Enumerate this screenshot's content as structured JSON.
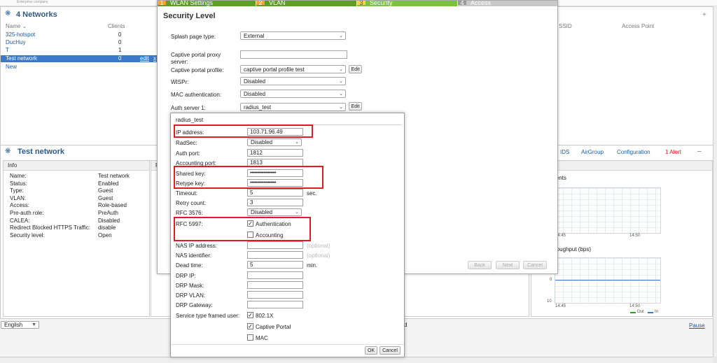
{
  "brand": "Enterprise company",
  "networks": {
    "title": "4 Networks",
    "col_name": "Name ⌄",
    "col_clients": "Clients",
    "col_ssid": "SSID",
    "col_ap": "Access Point",
    "rows": [
      {
        "name": "325-hotspot",
        "clients": "0"
      },
      {
        "name": "DucHuy",
        "clients": "0"
      },
      {
        "name": "T",
        "clients": "1"
      },
      {
        "name": "Test network",
        "clients": "0"
      }
    ],
    "edit": "edit",
    "delete": "x",
    "new": "New",
    "plus": "+"
  },
  "detail": {
    "title": "Test network",
    "tabs": [
      "IDS",
      "AirGroup",
      "Configuration"
    ],
    "alert": "1 Alert",
    "minimize": "–",
    "info_header": "Info",
    "info": [
      {
        "k": "Name:",
        "v": "Test network"
      },
      {
        "k": "Status:",
        "v": "Enabled"
      },
      {
        "k": "Type:",
        "v": "Guest"
      },
      {
        "k": "VLAN:",
        "v": "Guest"
      },
      {
        "k": "Access:",
        "v": "Role-based"
      },
      {
        "k": "Pre-auth role:",
        "v": "PreAuth"
      },
      {
        "k": "CALEA:",
        "v": "Disabled"
      },
      {
        "k": "Redirect Blocked HTTPS Traffic:",
        "v": "disable"
      },
      {
        "k": "Security level:",
        "v": "Open"
      }
    ],
    "mid_header": "R",
    "trends_header": "rends",
    "clients_title": "ients",
    "throughput_title": "roughput  (bps)",
    "tick_1445": "14:45",
    "tick_1450": "14:50",
    "y_0": "0",
    "y_10": "10",
    "legend_out": "Out",
    "legend_in": "In"
  },
  "footer": {
    "language": "English",
    "pause": "Pause",
    "d": "d"
  },
  "wizard": {
    "steps": [
      {
        "num": "1",
        "label": "WLAN Settings"
      },
      {
        "num": "2",
        "label": "VLAN"
      },
      {
        "num": "3",
        "label": "Security"
      },
      {
        "num": "4",
        "label": "Access"
      }
    ],
    "title": "Security Level",
    "splash_label": "Splash page type:",
    "splash_value": "External",
    "proxy_label": "Captive portal proxy server:",
    "proxy_value": "",
    "profile_label": "Captive portal profile:",
    "profile_value": "captive portal profile test",
    "wispr_label": "WISPr:",
    "wispr_value": "Disabled",
    "mac_label": "MAC authentication:",
    "mac_value": "Disabled",
    "auth_label": "Auth server 1:",
    "auth_value": "radius_test",
    "edit": "Edit",
    "back": "Back",
    "next": "Next",
    "cancel": "Cancel"
  },
  "radius": {
    "title": "radius_test",
    "ip_label": "IP address:",
    "ip_value": "103.71.96.49",
    "radsec_label": "RadSec:",
    "radsec_value": "Disabled",
    "authport_label": "Auth port:",
    "authport_value": "1812",
    "acctport_label": "Accounting port:",
    "acctport_value": "1813",
    "shared_label": "Shared key:",
    "shared_value": "•••••••••••••••••••",
    "retype_label": "Retype key:",
    "retype_value": "•••••••••••••••••••",
    "timeout_label": "Timeout:",
    "timeout_value": "5",
    "timeout_unit": "sec.",
    "retry_label": "Retry count:",
    "retry_value": "3",
    "rfc3576_label": "RFC 3576:",
    "rfc3576_value": "Disabled",
    "rfc5997_label": "RFC 5997:",
    "rfc5997_auth": "Authentication",
    "rfc5997_acct": "Accounting",
    "nasip_label": "NAS IP address:",
    "nasip_hint": "(optional)",
    "nasid_label": "NAS identifier:",
    "nasid_hint": "(optional)",
    "dead_label": "Dead time:",
    "dead_value": "5",
    "dead_unit": "min.",
    "drpip_label": "DRP IP:",
    "drpmask_label": "DRP Mask:",
    "drpvlan_label": "DRP VLAN:",
    "drpgw_label": "DRP Gateway:",
    "service_label": "Service type framed user:",
    "svc_8021x": "802.1X",
    "svc_captive": "Captive Portal",
    "svc_mac": "MAC",
    "ok": "OK",
    "cancel": "Cancel",
    "check": "✓"
  },
  "colors": {
    "highlight": "#e01b24",
    "selection": "#3a78c9",
    "step_active": "#7cc142",
    "step_done": "#5e9e24"
  }
}
